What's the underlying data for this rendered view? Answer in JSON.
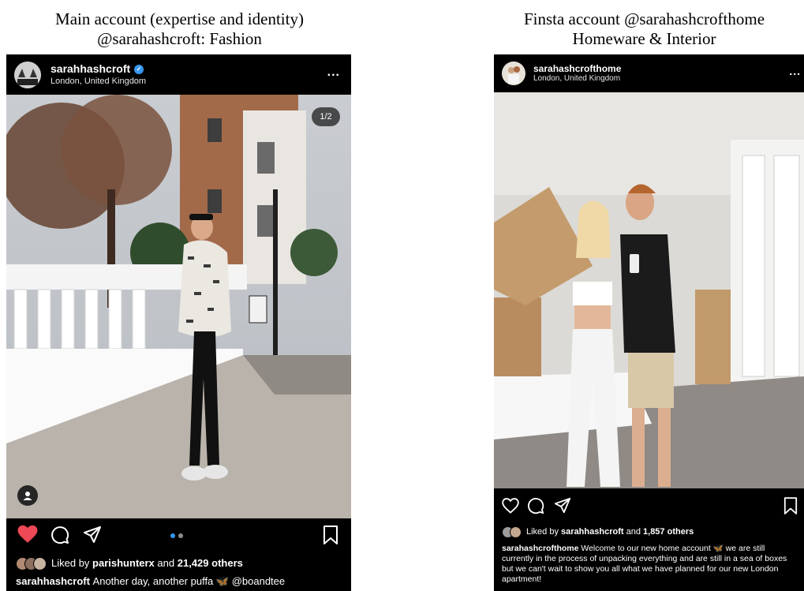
{
  "left_caption": {
    "line1": "Main account (expertise and identity)",
    "line2": "@sarahashcroft: Fashion"
  },
  "right_caption": {
    "line1": "Finsta account @sarahashcrofthome",
    "line2": "Homeware & Interior"
  },
  "left_post": {
    "username": "sarahhashcroft",
    "verified": true,
    "location": "London, United Kingdom",
    "more": "...",
    "photo_counter": "1/2",
    "liked": true,
    "liked_by_prefix": "Liked by",
    "liked_by_user": "parishunterx",
    "liked_by_and": "and",
    "liked_by_others": "21,429 others",
    "caption_user": "sarahhashcroft",
    "caption_text": "Another day, another puffa 🦋 @boandtee",
    "colors": {
      "like_red": "#ed4956",
      "carousel_active": "#3897f0"
    }
  },
  "right_post": {
    "username": "sarahashcrofthome",
    "location": "London, United Kingdom",
    "more": "...",
    "liked": false,
    "liked_by_prefix": "Liked by",
    "liked_by_user": "sarahhashcroft",
    "liked_by_and": "and",
    "liked_by_others": "1,857 others",
    "caption_user": "sarahashcrofthome",
    "caption_text": "Welcome to our new home account 🦋 we are still currently in the process of unpacking everything and are still in a sea of boxes but we can't wait to show you all what we have planned for our new London apartment!"
  }
}
